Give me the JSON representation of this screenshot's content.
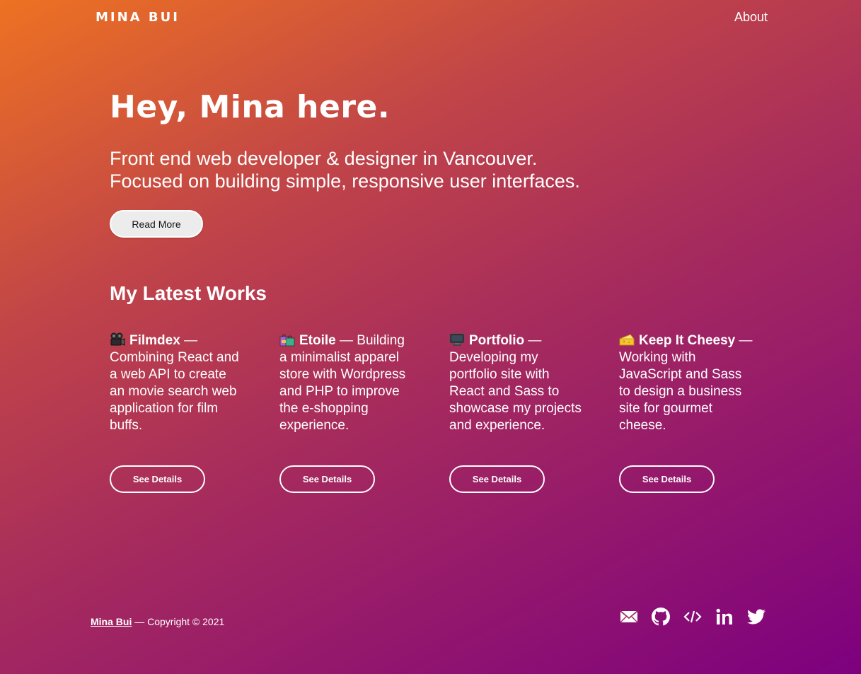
{
  "header": {
    "logo": "MINA BUI",
    "nav_about": "About"
  },
  "hero": {
    "title": "Hey, Mina here.",
    "subtitle_line1": "Front end web developer & designer in Vancouver.",
    "subtitle_line2": "Focused on building simple, responsive user interfaces.",
    "read_more_label": "Read More"
  },
  "works": {
    "title": "My Latest Works",
    "items": [
      {
        "icon": "film-camera-icon",
        "name": "Filmdex",
        "description": " — Combining React and a web API to create an movie search web application for film buffs.",
        "button_label": "See Details"
      },
      {
        "icon": "shopping-bags-icon",
        "name": "Etoile",
        "description": " — Building a minimalist apparel store with Wordpress and PHP to improve the e-shopping experience.",
        "button_label": "See Details"
      },
      {
        "icon": "computer-monitor-icon",
        "name": "Portfolio",
        "description": " — Developing my portfolio site with React and Sass to showcase my projects and experience.",
        "button_label": "See Details"
      },
      {
        "icon": "cheese-icon",
        "name": "Keep It Cheesy",
        "description": " — Working with JavaScript and Sass to design a business site for gourmet cheese.",
        "button_label": "See Details"
      }
    ]
  },
  "footer": {
    "name_link": "Mina Bui",
    "copyright": " — Copyright © 2021",
    "socials": [
      "mail-icon",
      "github-icon",
      "code-icon",
      "linkedin-icon",
      "twitter-icon"
    ]
  }
}
